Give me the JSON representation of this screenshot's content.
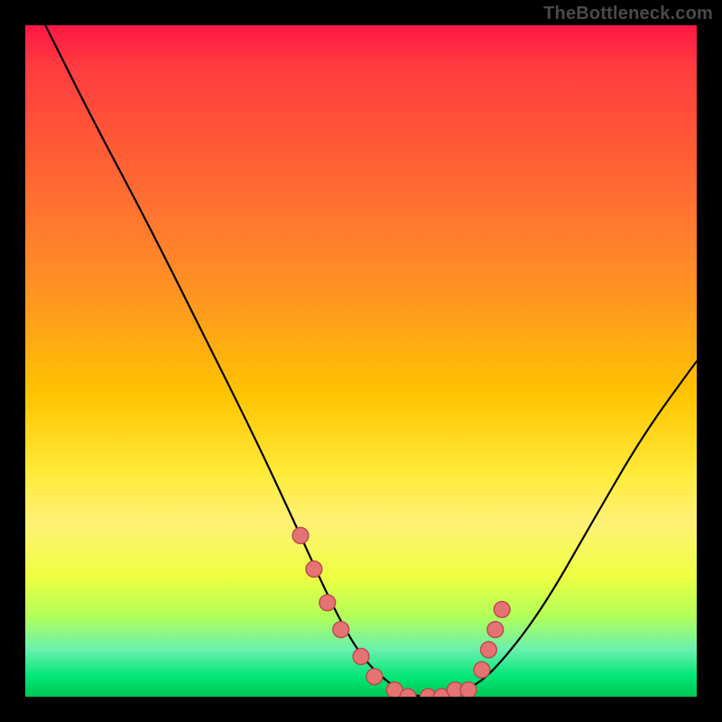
{
  "watermark": "TheBottleneck.com",
  "chart_data": {
    "type": "line",
    "title": "",
    "xlabel": "",
    "ylabel": "",
    "xlim": [
      0,
      100
    ],
    "ylim": [
      0,
      100
    ],
    "grid": false,
    "legend": false,
    "series": [
      {
        "name": "curve",
        "color": "#000000",
        "x": [
          3,
          10,
          18,
          26,
          34,
          41,
          46,
          50,
          54,
          58,
          62,
          66,
          70,
          77,
          85,
          92,
          100
        ],
        "y": [
          100,
          86,
          71,
          55,
          39,
          24,
          13,
          6,
          2,
          0,
          0,
          1,
          4,
          13,
          27,
          39,
          50
        ]
      }
    ],
    "markers": {
      "name": "highlight-dots",
      "color": "#e57373",
      "stroke": "#b74a4a",
      "radius": 1.2,
      "x": [
        41,
        43,
        45,
        47,
        50,
        52,
        55,
        57,
        60,
        62,
        64,
        66,
        68,
        69,
        70,
        71
      ],
      "y": [
        24,
        19,
        14,
        10,
        6,
        3,
        1,
        0,
        0,
        0,
        1,
        1,
        4,
        7,
        10,
        13
      ]
    }
  }
}
